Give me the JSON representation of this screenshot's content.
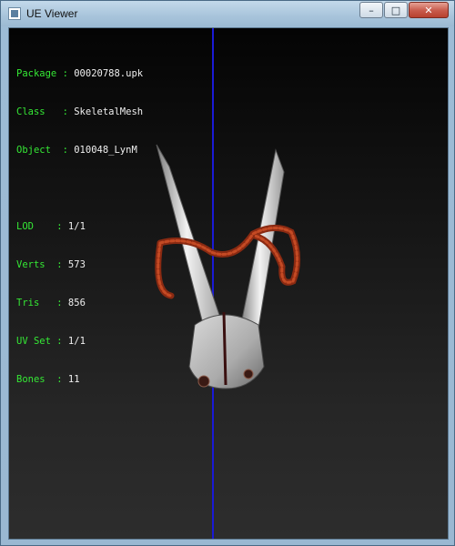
{
  "window": {
    "title": "UE Viewer",
    "buttons": {
      "minimize": "–",
      "maximize": "□",
      "close": "✕"
    }
  },
  "info_block_1": [
    {
      "label": "Package",
      "sep": " : ",
      "value": "00020788.upk",
      "label_padded": "Package"
    },
    {
      "label": "Class",
      "sep": " : ",
      "value": "SkeletalMesh",
      "label_padded": "Class  "
    },
    {
      "label": "Object",
      "sep": " : ",
      "value": "010048_LynM",
      "label_padded": "Object "
    }
  ],
  "info_block_2": [
    {
      "label": "LOD",
      "value": "1/1",
      "label_padded": "LOD    "
    },
    {
      "label": "Verts",
      "value": "573",
      "label_padded": "Verts  "
    },
    {
      "label": "Tris",
      "value": "856",
      "label_padded": "Tris   "
    },
    {
      "label": "UV Set",
      "value": "1/1",
      "label_padded": "UV Set "
    },
    {
      "label": "Bones",
      "value": "11",
      "label_padded": "Bones  "
    }
  ],
  "colors": {
    "label": "#35e835",
    "value": "#f0f0f0",
    "axis": "#1a1ad6",
    "viewport_top": "#040404",
    "viewport_bottom": "#2d2d2d"
  },
  "icons": {
    "app": "ue-viewer-app-icon",
    "minimize": "minimize-icon",
    "maximize": "maximize-icon",
    "close": "close-icon"
  }
}
